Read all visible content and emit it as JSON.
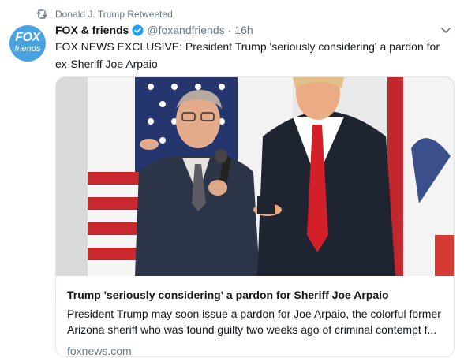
{
  "retweet": {
    "icon": "retweet-icon",
    "text": "Donald J. Trump Retweeted"
  },
  "author": {
    "avatar_icon": "fox-and-friends-logo",
    "avatar_line1": "FOX",
    "avatar_line2": "friends",
    "name": "FOX & friends",
    "verified_icon": "verified-badge-icon",
    "handle": "@foxandfriends",
    "separator": "·",
    "time": "16h"
  },
  "tweet": {
    "text": "FOX NEWS EXCLUSIVE: President Trump 'seriously considering' a pardon for ex-Sheriff Joe Arpaio"
  },
  "card": {
    "image_icon": "news-photo",
    "title": "Trump 'seriously considering' a pardon for Sheriff Joe Arpaio",
    "description": "President Trump may soon issue a pardon for Joe Arpaio, the colorful former Arizona sheriff who was found guilty two weeks ago of criminal contempt f...",
    "domain": "foxnews.com"
  },
  "menu": {
    "icon": "chevron-down-icon"
  },
  "colors": {
    "secondary_text": "#657786",
    "verified_blue": "#1da1f2",
    "card_border": "#e1e8ed",
    "avatar_bg": "#4aa3e0"
  }
}
